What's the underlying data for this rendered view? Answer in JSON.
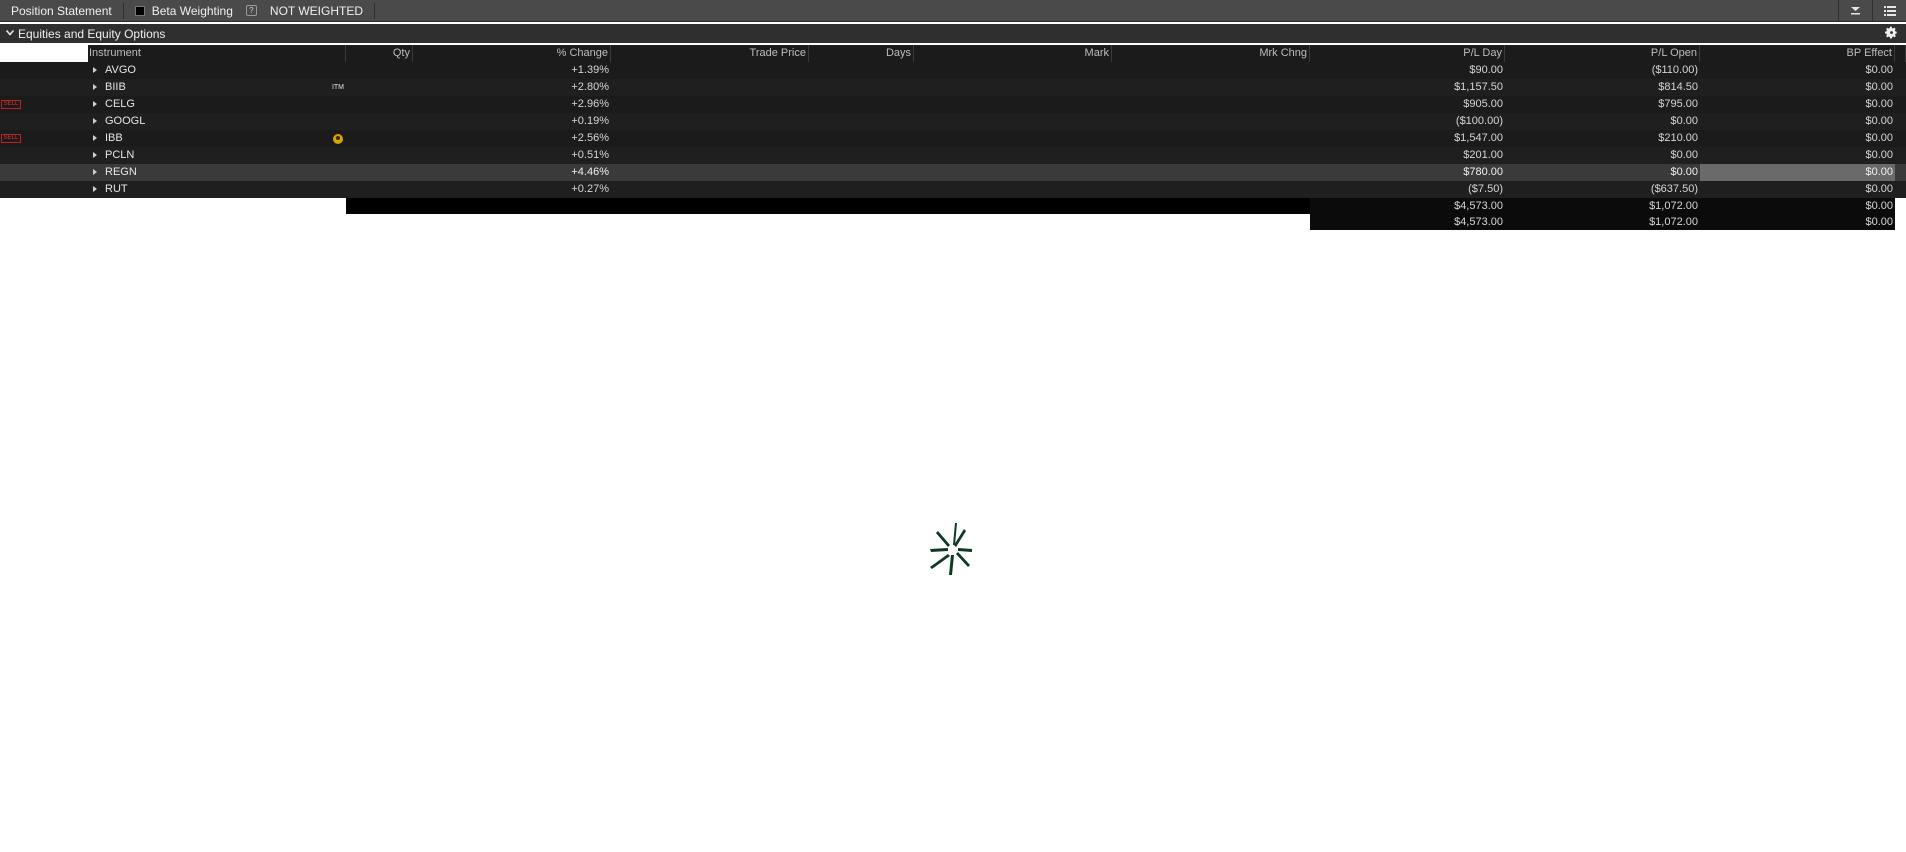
{
  "toolbar": {
    "title": "Position Statement",
    "beta_weighting_label": "Beta Weighting",
    "beta_weighting_checked": false,
    "help_glyph": "?",
    "weighting_value": "NOT WEIGHTED",
    "icons": [
      "collapse-all-icon",
      "list-menu-icon"
    ]
  },
  "section": {
    "title": "Equities and Equity Options",
    "icons": [
      "chevron-down-icon",
      "gear-icon"
    ]
  },
  "columns": {
    "instrument": "Instrument",
    "qty": "Qty",
    "pct_change": "% Change",
    "trade_price": "Trade Price",
    "days": "Days",
    "mark": "Mark",
    "mrk_chng": "Mrk Chng",
    "pl_day": "P/L Day",
    "pl_open": "P/L Open",
    "bp_effect": "BP Effect"
  },
  "rows": [
    {
      "symbol": "AVGO",
      "pct_change": "+1.39%",
      "pl_day": "$90.00",
      "pl_open": "($110.00)",
      "bp_effect": "$0.00",
      "flag": "",
      "tag": ""
    },
    {
      "symbol": "BIIB",
      "pct_change": "+2.80%",
      "pl_day": "$1,157.50",
      "pl_open": "$814.50",
      "bp_effect": "$0.00",
      "flag": "",
      "tag": "ITM"
    },
    {
      "symbol": "CELG",
      "pct_change": "+2.96%",
      "pl_day": "$905.00",
      "pl_open": "$795.00",
      "bp_effect": "$0.00",
      "flag": "SELL",
      "tag": ""
    },
    {
      "symbol": "GOOGL",
      "pct_change": "+0.19%",
      "pl_day": "($100.00)",
      "pl_open": "$0.00",
      "bp_effect": "$0.00",
      "flag": "",
      "tag": ""
    },
    {
      "symbol": "IBB",
      "pct_change": "+2.56%",
      "pl_day": "$1,547.00",
      "pl_open": "$210.00",
      "bp_effect": "$0.00",
      "flag": "SELL",
      "tag": "alert-badge"
    },
    {
      "symbol": "PCLN",
      "pct_change": "+0.51%",
      "pl_day": "$201.00",
      "pl_open": "$0.00",
      "bp_effect": "$0.00",
      "flag": "",
      "tag": ""
    },
    {
      "symbol": "REGN",
      "pct_change": "+4.46%",
      "pl_day": "$780.00",
      "pl_open": "$0.00",
      "bp_effect": "$0.00",
      "flag": "",
      "tag": "",
      "selected": true
    },
    {
      "symbol": "RUT",
      "pct_change": "+0.27%",
      "pl_day": "($7.50)",
      "pl_open": "($637.50)",
      "bp_effect": "$0.00",
      "flag": "",
      "tag": ""
    }
  ],
  "totals": [
    {
      "pl_day": "$4,573.00",
      "pl_open": "$1,072.00",
      "bp_effect": "$0.00"
    },
    {
      "pl_day": "$4,573.00",
      "pl_open": "$1,072.00",
      "bp_effect": "$0.00"
    }
  ],
  "colors": {
    "toolbar_bg": "#4a4a4a",
    "table_bg": "#1b1b1b",
    "selected_row": "#3a3a3a",
    "sell_flag": "#e03030",
    "alert_badge": "#d9a300",
    "spinner": "#0e3a24"
  },
  "loading_indicator": "spinner-icon"
}
